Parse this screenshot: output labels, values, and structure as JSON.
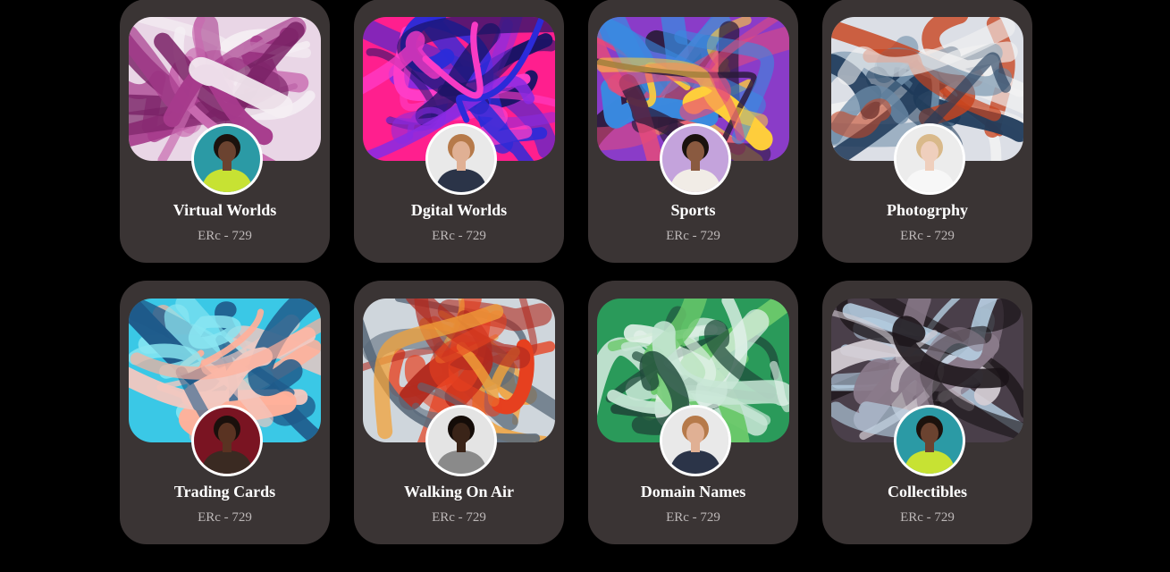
{
  "collections": [
    {
      "name": "Virtual Worlds",
      "standard": "ERc - 729",
      "banner_colors": [
        "#e9d6e6",
        "#a63a8c",
        "#f5eef3",
        "#7a2266",
        "#c86ab0"
      ],
      "avatar_bg": "#2b9aa5",
      "avatar_skin": "#6b4330",
      "avatar_shirt": "#c7e233",
      "avatar_hair": "#1c120d"
    },
    {
      "name": "Dgital Worlds",
      "standard": "ERc - 729",
      "banner_colors": [
        "#ff1f8e",
        "#2b2bd9",
        "#ff3cc8",
        "#1a1466",
        "#8a2be2"
      ],
      "avatar_bg": "#e9e9e9",
      "avatar_skin": "#e0b094",
      "avatar_shirt": "#2b3448",
      "avatar_hair": "#b67a4a"
    },
    {
      "name": "Sports",
      "standard": "ERc - 729",
      "banner_colors": [
        "#8a3cc8",
        "#ffcf3a",
        "#e64a7a",
        "#2a1b3a",
        "#3a8ae0"
      ],
      "avatar_bg": "#c4a3dc",
      "avatar_skin": "#8a5a40",
      "avatar_shirt": "#f1ece6",
      "avatar_hair": "#1a120e"
    },
    {
      "name": "Photogrphy",
      "standard": "ERc - 729",
      "banner_colors": [
        "#dcdfe6",
        "#c8441f",
        "#1f3a5a",
        "#f2f2f2",
        "#6b8aa6"
      ],
      "avatar_bg": "#ececec",
      "avatar_skin": "#efcfbd",
      "avatar_shirt": "#f7f7f7",
      "avatar_hair": "#d9b98a"
    },
    {
      "name": "Trading Cards",
      "standard": "ERc - 729",
      "banner_colors": [
        "#3ac8e6",
        "#1f5a8a",
        "#ffb09a",
        "#8ae6f2",
        "#f2c8c0"
      ],
      "avatar_bg": "#7a1422",
      "avatar_skin": "#5a3322",
      "avatar_shirt": "#3a2a22",
      "avatar_hair": "#1a100c"
    },
    {
      "name": "Walking On Air",
      "standard": "ERc - 729",
      "banner_colors": [
        "#cfd6dc",
        "#e6401f",
        "#f2a23a",
        "#5a6a7a",
        "#b02a1f"
      ],
      "avatar_bg": "#e4e4e4",
      "avatar_skin": "#3a2418",
      "avatar_shirt": "#8a8a8a",
      "avatar_hair": "#140c08"
    },
    {
      "name": "Domain Names",
      "standard": "ERc - 729",
      "banner_colors": [
        "#2a9a5a",
        "#e6f2ec",
        "#1f4a3a",
        "#6ac86a",
        "#c8e6d6"
      ],
      "avatar_bg": "#e9e9e9",
      "avatar_skin": "#e0b094",
      "avatar_shirt": "#2b3448",
      "avatar_hair": "#b67a4a"
    },
    {
      "name": "Collectibles",
      "standard": "ERc - 729",
      "banner_colors": [
        "#4a3f4a",
        "#b8d2e6",
        "#1a1418",
        "#8a7a8a",
        "#d6cfd6"
      ],
      "avatar_bg": "#2b9aa5",
      "avatar_skin": "#6b4330",
      "avatar_shirt": "#c7e233",
      "avatar_hair": "#1c120d"
    }
  ]
}
